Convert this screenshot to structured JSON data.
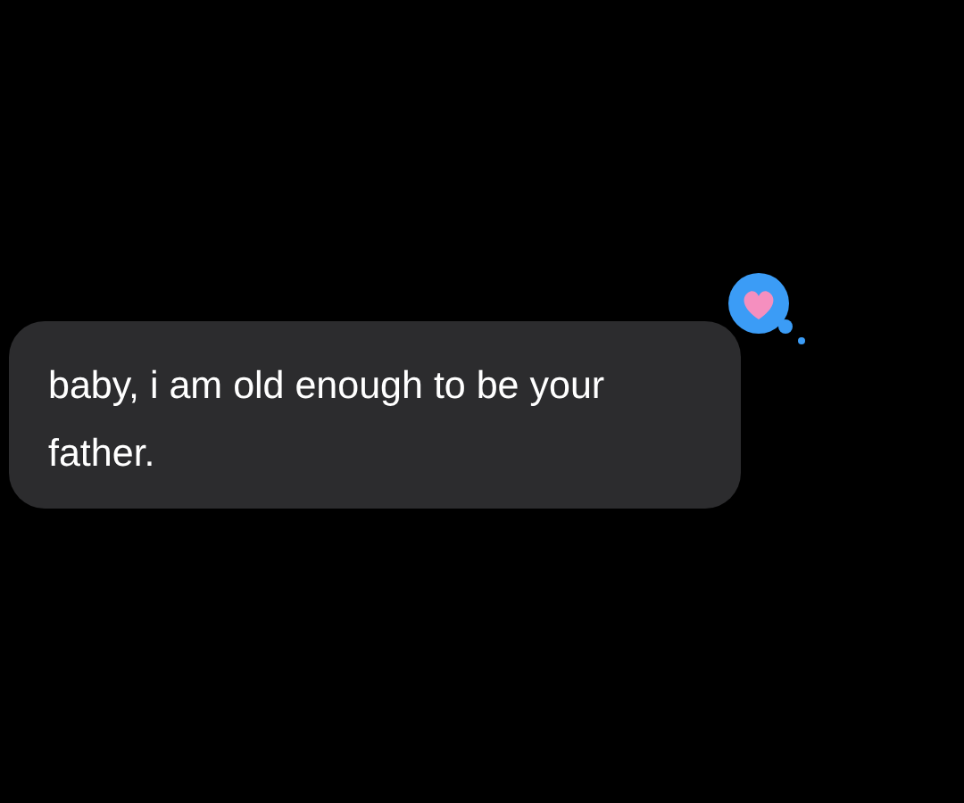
{
  "messages": [
    {
      "text": "baby, i am old enough to be your father.",
      "reaction": {
        "kind": "heart"
      }
    }
  ]
}
